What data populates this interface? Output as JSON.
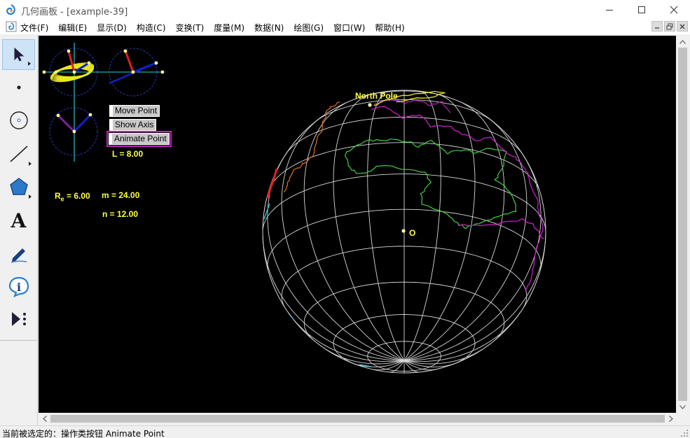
{
  "window": {
    "title": "几何画板 - [example-39]"
  },
  "menu": {
    "items": [
      "文件(F)",
      "编辑(E)",
      "显示(D)",
      "构造(C)",
      "变换(T)",
      "度量(M)",
      "数据(N)",
      "绘图(G)",
      "窗口(W)",
      "帮助(H)"
    ]
  },
  "toolbox": {
    "tools": [
      {
        "name": "arrow-tool",
        "icon": "arrow-cursor-icon",
        "selected": true
      },
      {
        "name": "point-tool",
        "icon": "dot-icon"
      },
      {
        "name": "compass-tool",
        "icon": "circle-icon"
      },
      {
        "name": "straightedge-tool",
        "icon": "line-segment-icon"
      },
      {
        "name": "polygon-tool",
        "icon": "pentagon-icon"
      },
      {
        "name": "text-tool",
        "icon": "letter-a-icon",
        "glyph": "A"
      },
      {
        "name": "marker-tool",
        "icon": "pen-icon"
      },
      {
        "name": "information-tool",
        "icon": "info-icon"
      },
      {
        "name": "custom-tool",
        "icon": "play-menu-icon"
      }
    ]
  },
  "sketch": {
    "buttons": {
      "move_point": "Move Point",
      "show_axis": "Show Axis",
      "animate_point": "Animate Point"
    },
    "measurements": {
      "L": "L = 8.00",
      "Re_symbol": "R",
      "Re_sub": "e",
      "Re_value": " = 6.00",
      "m": "m = 24.00",
      "n": "n = 12.00"
    },
    "labels": {
      "north_pole": "North Pole",
      "center": "O"
    },
    "colors": {
      "background": "#000000",
      "grid": "#d8d8d8",
      "label": "#ffff40",
      "axis": "#30d0e0",
      "continent_green": "#40d040",
      "continent_magenta": "#d020d0",
      "continent_orange": "#e07020",
      "continent_yellow": "#e8e820",
      "continent_red": "#e02020"
    }
  },
  "status": {
    "text": "当前被选定的：操作类按钮 Animate Point"
  }
}
